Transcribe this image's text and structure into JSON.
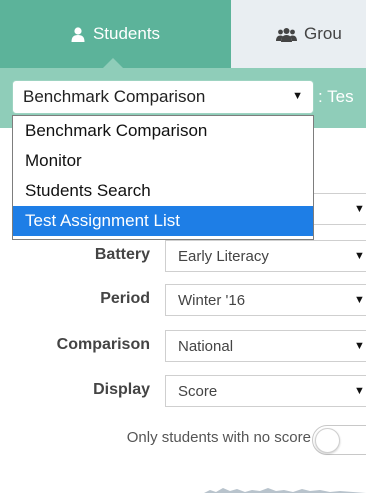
{
  "tabs": [
    {
      "label": "Students",
      "icon": "user-icon",
      "active": true
    },
    {
      "label": "Grou",
      "icon": "users-group-icon",
      "active": false
    }
  ],
  "toolbar": {
    "report_select": {
      "value": "Benchmark Comparison"
    },
    "suffix": ": Tes"
  },
  "report_menu": {
    "options": [
      "Benchmark Comparison",
      "Monitor",
      "Students Search",
      "Test Assignment List"
    ],
    "highlighted_index": 3
  },
  "filters": [
    {
      "label": "",
      "value": ""
    },
    {
      "label": "Battery",
      "value": "Early Literacy"
    },
    {
      "label": "Period",
      "value": "Winter '16"
    },
    {
      "label": "Comparison",
      "value": "National"
    },
    {
      "label": "Display",
      "value": "Score"
    }
  ],
  "toggle": {
    "label": "Only students with no score",
    "checked": false
  },
  "colors": {
    "tab_active": "#5cb39a",
    "toolbar": "#8fcdb9",
    "tab_inactive": "#e9eef2",
    "highlight": "#1e7ee6"
  }
}
